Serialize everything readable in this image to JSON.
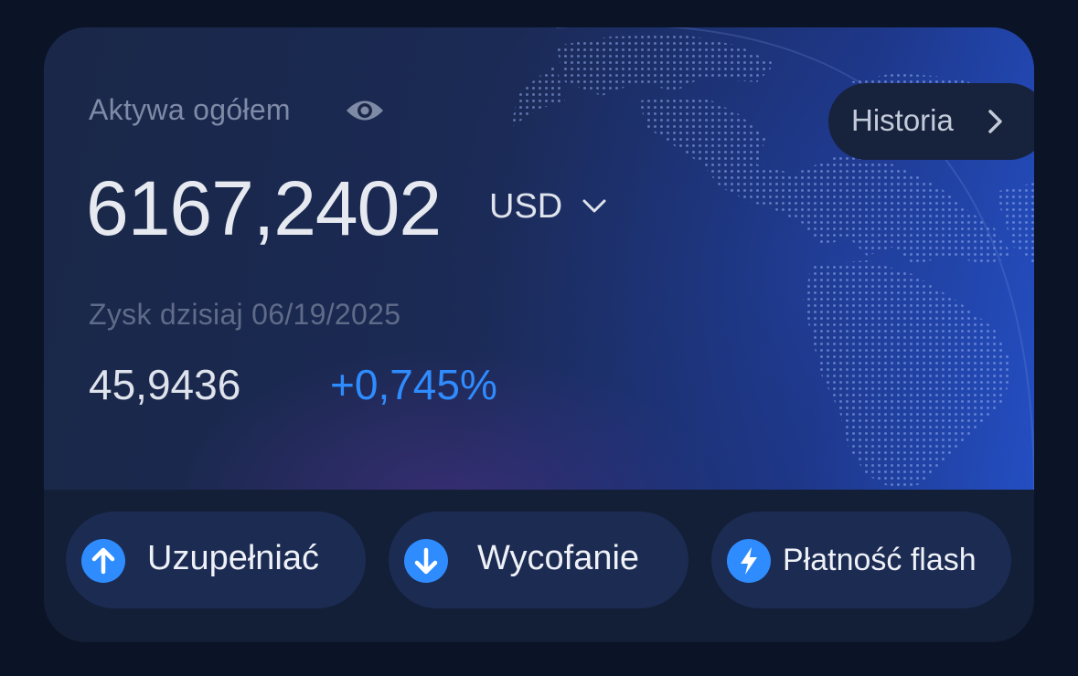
{
  "assets": {
    "label": "Aktywa ogółem",
    "balance": "6167,2402",
    "currency": "USD",
    "history_label": "Historia"
  },
  "profit": {
    "label": "Zysk dzisiaj 06/19/2025",
    "value": "45,9436",
    "percent": "+0,745%"
  },
  "actions": [
    {
      "label": "Uzupełniać",
      "icon": "arrow-up-icon"
    },
    {
      "label": "Wycofanie",
      "icon": "arrow-down-icon"
    },
    {
      "label": "Płatność flash",
      "icon": "lightning-icon"
    }
  ],
  "colors": {
    "accent": "#2f8cff",
    "background": "#0b1327",
    "card": "#131e37",
    "button": "#1c2b52"
  }
}
